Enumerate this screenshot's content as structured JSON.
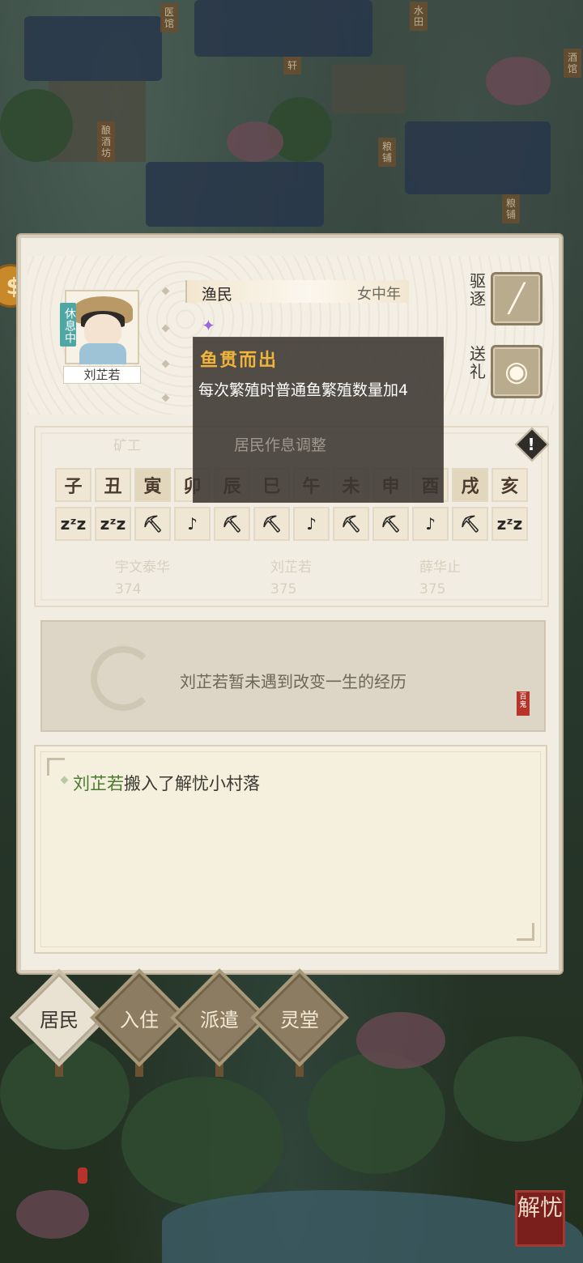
{
  "world": {
    "banners": [
      "医馆",
      "水田",
      "轩",
      "酒馆",
      "酿酒坊",
      "粮铺",
      "粮铺"
    ]
  },
  "resident": {
    "status": "休息中",
    "name": "刘芷若",
    "job": "渔民",
    "gender_age": "女中年",
    "actions": {
      "expel_label": "驱逐",
      "gift_label": "送礼"
    }
  },
  "tooltip": {
    "title": "鱼贯而出",
    "description": "每次繁殖时普通鱼繁殖数量加4",
    "subtitle": "居民作息调整"
  },
  "schedule": {
    "ghost_labels": [
      "矿工",
      "宇文泰华",
      "刘芷若",
      "薛华止",
      "374",
      "375",
      "375"
    ],
    "hours": [
      "子",
      "丑",
      "寅",
      "卯",
      "辰",
      "巳",
      "午",
      "未",
      "申",
      "酉",
      "戌",
      "亥"
    ],
    "activities": [
      "sleep",
      "sleep",
      "work",
      "leisure",
      "work",
      "work",
      "leisure",
      "work",
      "work",
      "leisure",
      "work",
      "sleep"
    ],
    "activity_icons": {
      "sleep": "zzz-icon",
      "work": "pickaxe-icon",
      "leisure": "music-person-icon"
    }
  },
  "experience": {
    "text": "刘芷若暂未遇到改变一生的经历",
    "seal": "百鬼"
  },
  "log": {
    "entries": [
      {
        "name": "刘芷若",
        "text": "搬入了解忧小村落"
      }
    ]
  },
  "tabs": [
    {
      "label": "居民",
      "active": true
    },
    {
      "label": "入住",
      "active": false
    },
    {
      "label": "派遣",
      "active": false
    },
    {
      "label": "灵堂",
      "active": false
    }
  ],
  "corner_button": "解忧",
  "colors": {
    "panel_bg": "#f1ede2",
    "tooltip_title": "#f1b43b",
    "log_name": "#4b7a2f",
    "status_tag": "#4fa7a4"
  }
}
